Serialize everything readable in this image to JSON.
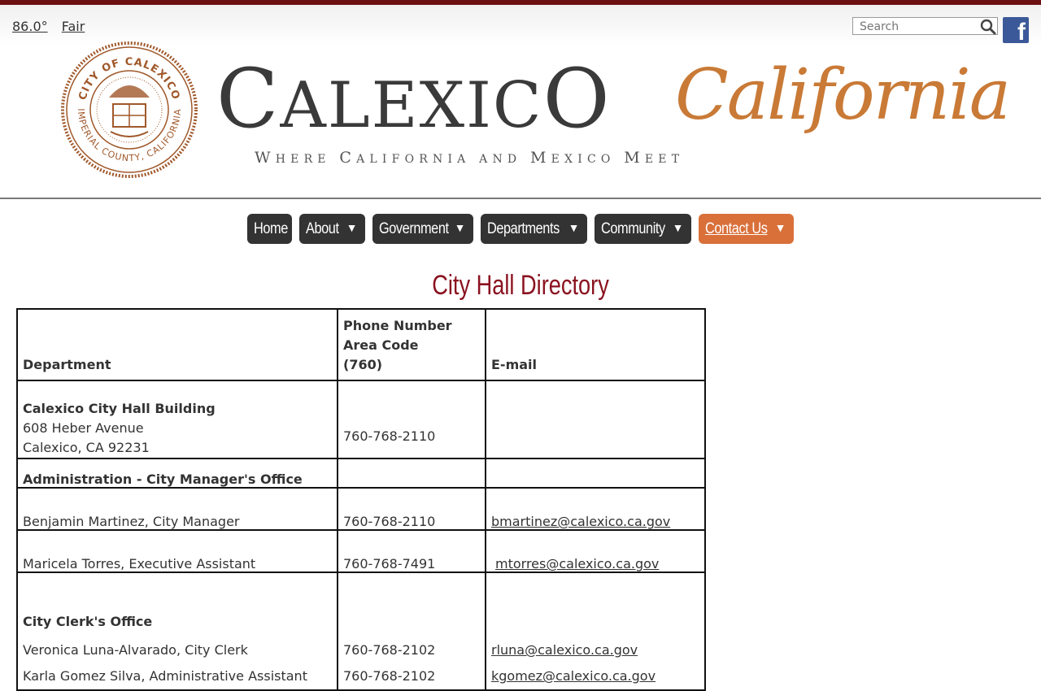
{
  "weather": {
    "temp": "86.0°",
    "condition": "Fair"
  },
  "search": {
    "placeholder": "Search",
    "value": ""
  },
  "social": {
    "facebook_glyph": "f"
  },
  "logo": {
    "word_first": "C",
    "word_mid": "ALEXIC",
    "word_last": "O",
    "script": "California",
    "tagline_parts": [
      "W",
      "HERE ",
      "C",
      "ALIFORNIA AND ",
      "M",
      "EXICO ",
      "M",
      "EET"
    ],
    "seal_top": "CITY OF CALEXICO",
    "seal_bottom": "IMPERIAL COUNTY, CALIFORNIA"
  },
  "nav": {
    "items": [
      {
        "label": "Home",
        "dropdown": false,
        "active": false
      },
      {
        "label": "About",
        "dropdown": true,
        "active": false
      },
      {
        "label": "Government",
        "dropdown": true,
        "active": false
      },
      {
        "label": "Departments",
        "dropdown": true,
        "active": false
      },
      {
        "label": "Community",
        "dropdown": true,
        "active": false
      },
      {
        "label": "Contact Us",
        "dropdown": true,
        "active": true
      }
    ],
    "arrow": "▼"
  },
  "page": {
    "title": "City Hall Directory"
  },
  "table": {
    "headers": {
      "department": "Department",
      "phone_1": "Phone Number",
      "phone_2": "Area Code",
      "phone_3": "(760)",
      "email": "E-mail"
    },
    "building": {
      "name": "Calexico City Hall Building",
      "address1": "608 Heber Avenue",
      "address2": "Calexico, CA  92231",
      "phone": "760-768-2110"
    },
    "admin_section": "Administration - City Manager's Office",
    "rows": [
      {
        "dept": "Benjamin Martinez, City Manager",
        "phone": "760-768-2110",
        "email": "bmartinez@calexico.ca.gov"
      },
      {
        "dept": "Maricela Torres, Executive Assistant",
        "phone": "760-768-7491",
        "email": "mtorres@calexico.ca.gov"
      }
    ],
    "clerk": {
      "section": "City Clerk's Office",
      "people": [
        {
          "name": "Veronica Luna-Alvarado, City Clerk",
          "phone": "760-768-2102",
          "email": "rluna@calexico.ca.gov"
        },
        {
          "name": "Karla Gomez Silva, Administrative Assistant",
          "phone": "760-768-2102",
          "email": "kgomez@calexico.ca.gov"
        }
      ]
    }
  },
  "colors": {
    "brand_dark_red": "#6b0f10",
    "title_red": "#8b1220",
    "nav_dark": "#333333",
    "nav_active": "#d9703a",
    "script_orange": "#c97a36"
  }
}
